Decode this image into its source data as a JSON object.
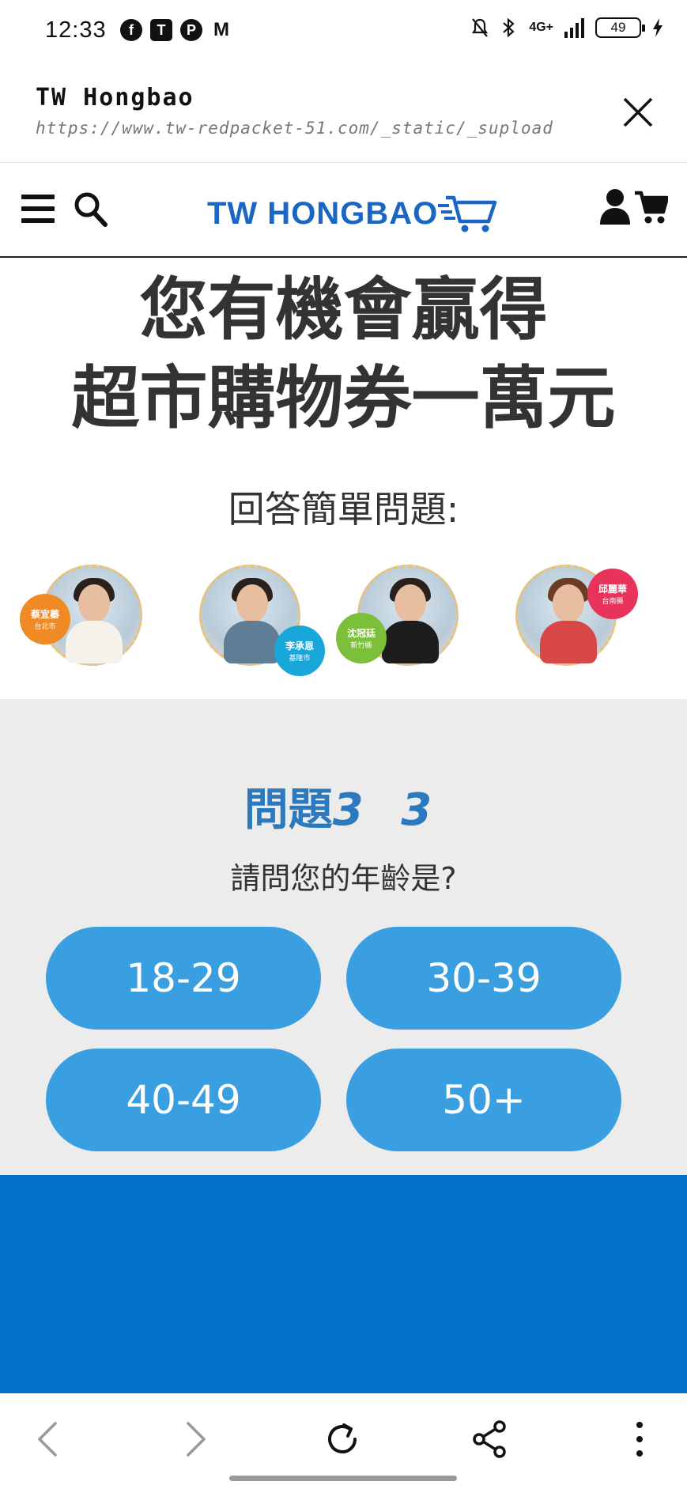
{
  "status_bar": {
    "time": "12:33",
    "apps": [
      "f",
      "T",
      "P",
      "M"
    ],
    "network": "4G+",
    "battery": "49"
  },
  "browser": {
    "title": "TW Hongbao",
    "url": "https://www.tw-redpacket-51.com/_static/_supload"
  },
  "site": {
    "logo_text": "TW HONGBAO",
    "brand_color": "#1a66c4"
  },
  "hero": {
    "title_line1": "您有機會贏得",
    "title_line2": "超市購物券一萬元",
    "subtitle": "回答簡單問題:"
  },
  "winners": [
    {
      "name": "蔡宜蓁",
      "city": "台北市",
      "badge_color": "#f08a24"
    },
    {
      "name": "李承恩",
      "city": "基隆市",
      "badge_color": "#19a6d9"
    },
    {
      "name": "沈冠廷",
      "city": "新竹縣",
      "badge_color": "#7cbf3a"
    },
    {
      "name": "邱麗華",
      "city": "台南縣",
      "badge_color": "#e8335a"
    }
  ],
  "question": {
    "heading_prefix": "問題",
    "heading_number": "3 3",
    "text": "請問您的年齡是?",
    "answers": [
      "18-29",
      "30-39",
      "40-49",
      "50+"
    ],
    "accent_color": "#3a9fe0"
  },
  "bottom_bar": {
    "icons": [
      "back-icon",
      "forward-icon",
      "reload-icon",
      "share-icon",
      "more-icon"
    ]
  }
}
